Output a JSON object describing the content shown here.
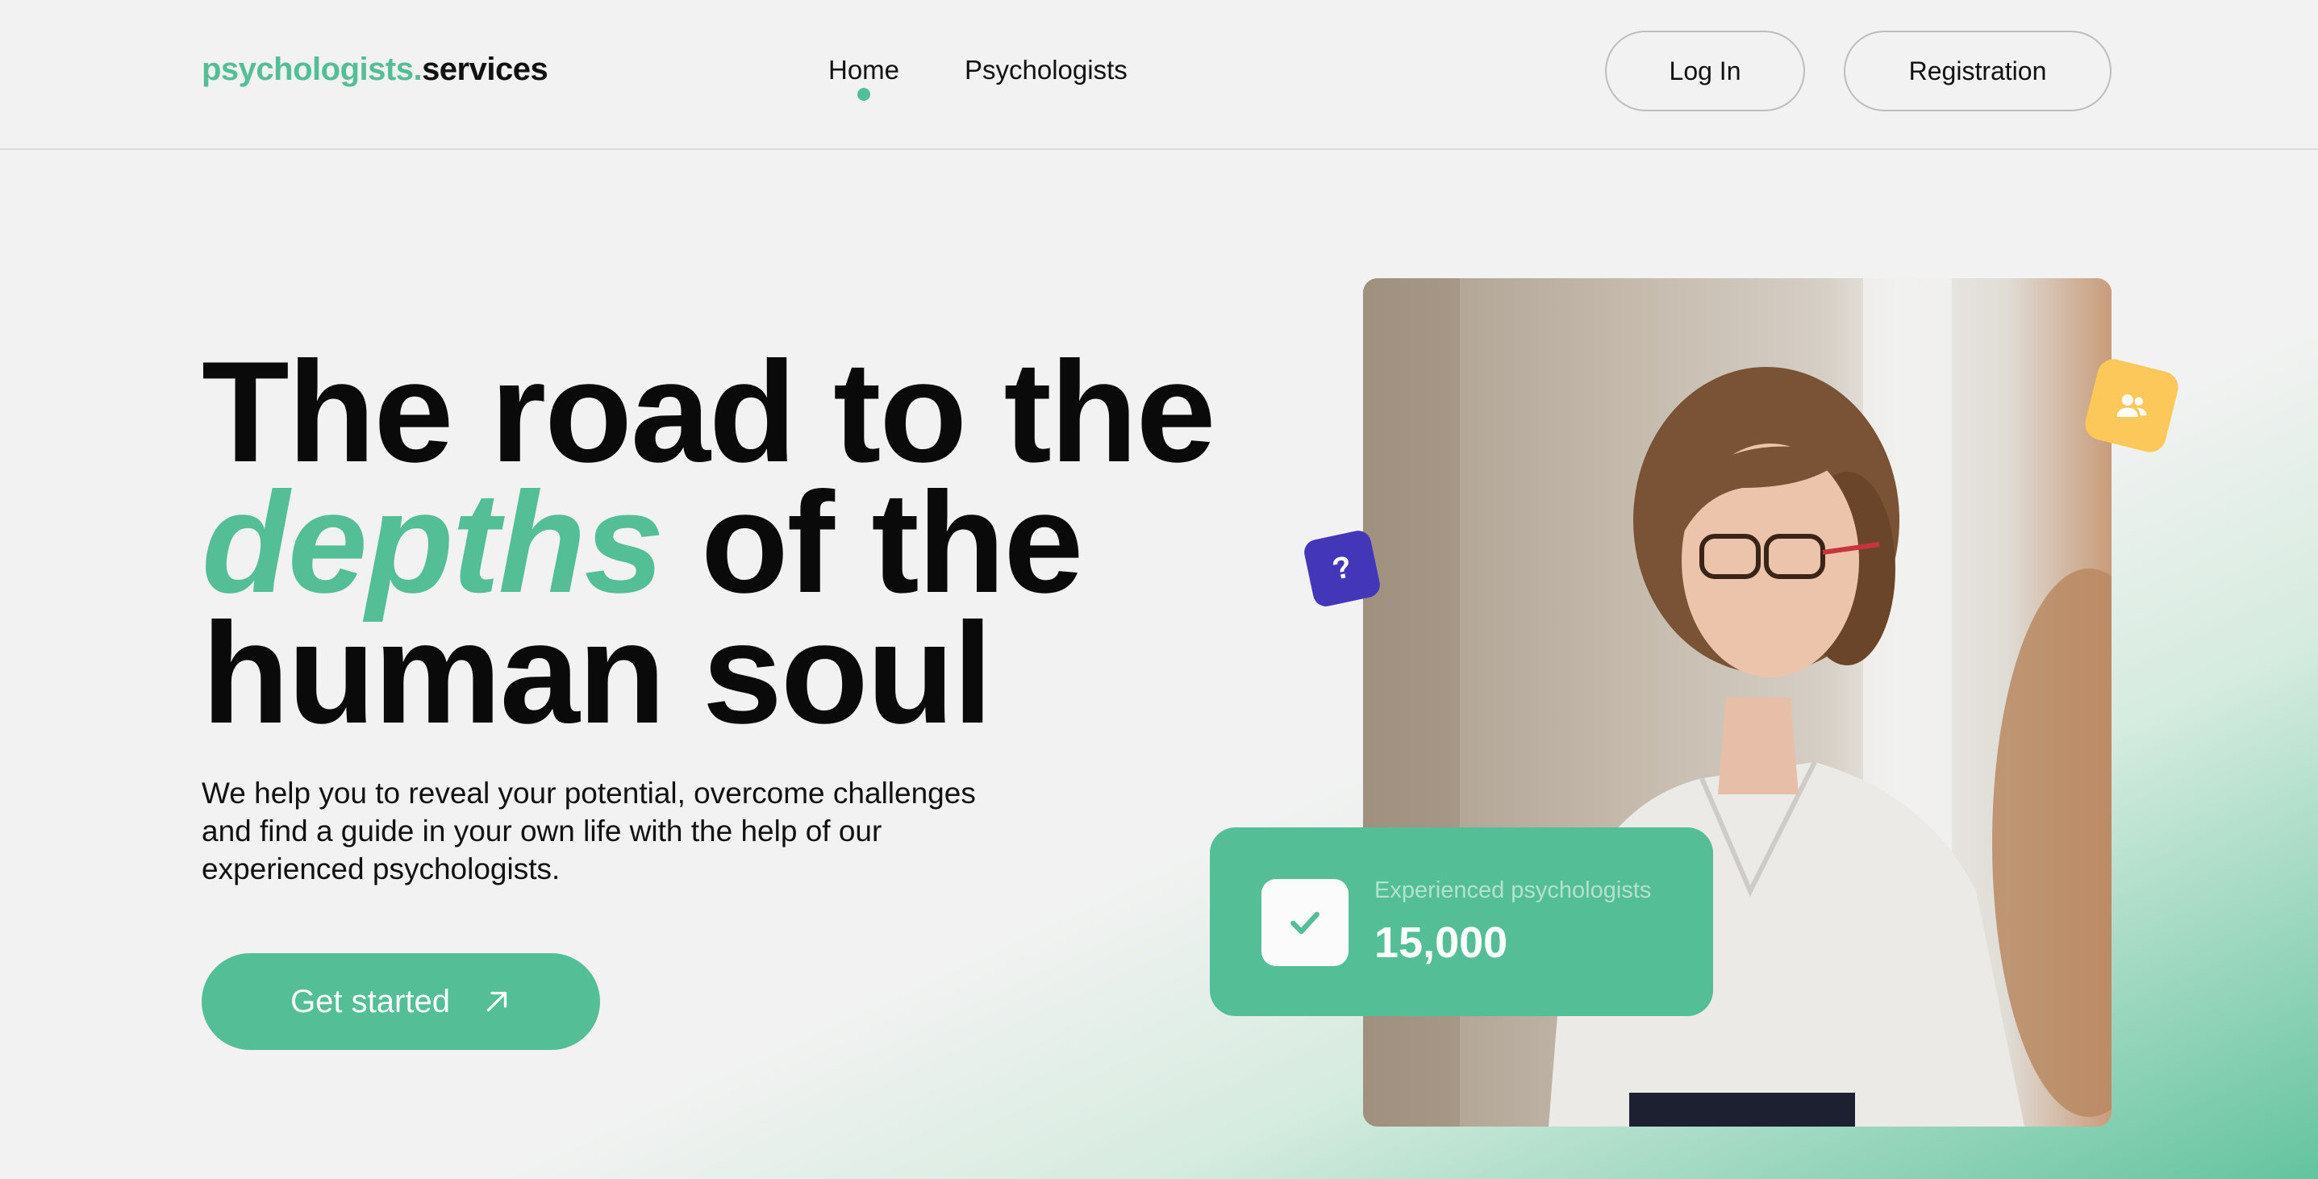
{
  "colors": {
    "accent": "#54be96",
    "background": "#f2f2f2",
    "question_badge": "#4436b8",
    "users_badge": "#fcc85a"
  },
  "header": {
    "logo_accent": "psychologists.",
    "logo_rest": "services",
    "nav": [
      {
        "label": "Home",
        "active": true
      },
      {
        "label": "Psychologists",
        "active": false
      }
    ],
    "login_label": "Log In",
    "register_label": "Registration"
  },
  "hero": {
    "title_line1": "The road to the",
    "title_accent": "depths",
    "title_line2_rest": " of the",
    "title_line3": "human soul",
    "subtitle": "We help you to reveal your potential, overcome challenges and find a guide in your own life with the help of our experienced psychologists.",
    "cta_label": "Get started",
    "cta_icon": "arrow-up-right-icon"
  },
  "badges": {
    "question_mark": "?",
    "question_icon": "question-icon",
    "users_icon": "users-icon"
  },
  "stat": {
    "icon": "check-icon",
    "label": "Experienced psychologists",
    "value": "15,000"
  }
}
